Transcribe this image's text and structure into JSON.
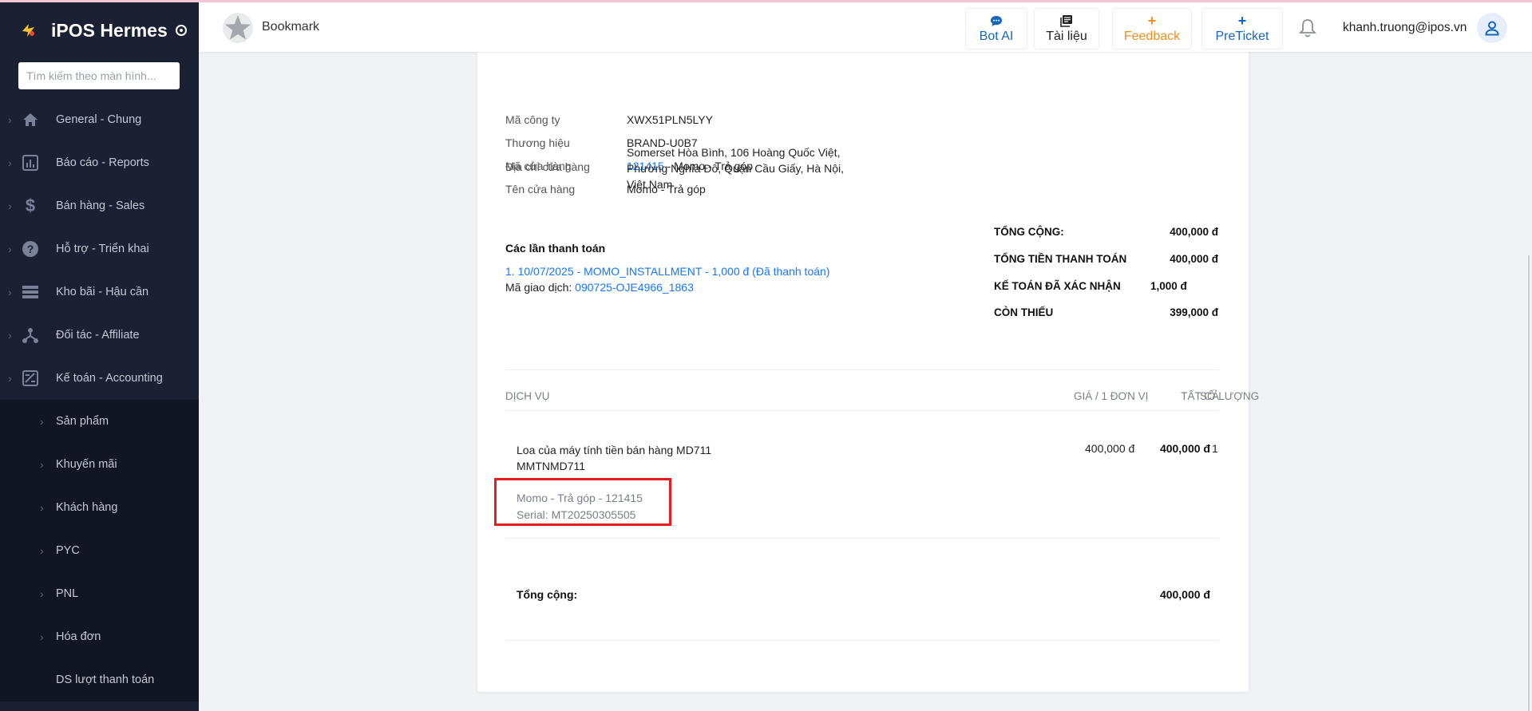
{
  "app": {
    "name": "iPOS Hermes"
  },
  "sidebar": {
    "search_placeholder": "Tìm kiếm theo màn hình...",
    "items": [
      {
        "label": "General - Chung",
        "icon": "home-icon"
      },
      {
        "label": "Báo cáo - Reports",
        "icon": "report-icon"
      },
      {
        "label": "Bán hàng - Sales",
        "icon": "dollar-icon"
      },
      {
        "label": "Hỗ trợ - Triển khai",
        "icon": "help-icon"
      },
      {
        "label": "Kho bãi - Hậu cần",
        "icon": "warehouse-icon"
      },
      {
        "label": "Đối tác - Affiliate",
        "icon": "affiliate-icon"
      },
      {
        "label": "Kế toán - Accounting",
        "icon": "accounting-icon"
      }
    ],
    "sub_items": [
      {
        "label": "Sản phẩm"
      },
      {
        "label": "Khuyến mãi"
      },
      {
        "label": "Khách hàng"
      },
      {
        "label": "PYC"
      },
      {
        "label": "PNL"
      },
      {
        "label": "Hóa đơn"
      },
      {
        "label": "DS lượt thanh toán"
      }
    ]
  },
  "header": {
    "bookmark_label": "Bookmark",
    "buttons": {
      "bot_ai": "Bot AI",
      "docs": "Tài liệu",
      "feedback": "Feedback",
      "preticket": "PreTicket"
    },
    "user_email": "khanh.truong@ipos.vn"
  },
  "invoice": {
    "info": {
      "company_code_label": "Mã công ty",
      "company_code": "XWX51PLN5LYY",
      "brand_label": "Thương hiệu",
      "brand": "BRAND-U0B7",
      "store_code_label": "Mã cửa hàng",
      "store_code": "121415",
      "store_code_suffix": "- Momo - Trả góp",
      "store_name_label": "Tên cửa hàng",
      "store_name": "Momo - Trả góp",
      "store_address_label": "Địa chỉ cửa hàng",
      "store_address": "Somerset Hòa Bình, 106 Hoàng Quốc Việt, Phường Nghĩa Đô, Quận Cầu Giấy, Hà Nội, Việt Nam"
    },
    "payments": {
      "title": "Các lần thanh toán",
      "line": "1. 10/07/2025 - MOMO_INSTALLMENT - 1,000 đ (Đã thanh toán)",
      "txn_label": "Mã giao dịch:",
      "txn_code": "090725-OJE4966_1863"
    },
    "totals": {
      "total_label": "TỔNG CỘNG:",
      "total_value": "400,000 đ",
      "payable_label": "TỔNG TIỀN THANH TOÁN",
      "payable_value": "400,000 đ",
      "confirmed_label": "KẾ TOÁN ĐÃ XÁC NHẬN",
      "confirmed_value": "1,000 đ",
      "remaining_label": "CÒN THIẾU",
      "remaining_value": "399,000 đ"
    },
    "table": {
      "headers": {
        "service": "DỊCH VỤ",
        "unit_price": "GIÁ / 1 ĐƠN VỊ",
        "quantity": "SỐ LƯỢNG",
        "total": "TẤT CẢ"
      },
      "row": {
        "name": "Loa của máy tính tiền bán hàng MD711",
        "code": "MMTNMD711",
        "store_line": "Momo - Trả góp - 121415",
        "serial": "Serial: MT20250305505",
        "unit_price": "400,000 đ",
        "quantity": "1",
        "total": "400,000 đ"
      },
      "grand_total_label": "Tổng cộng:",
      "grand_total_value": "400,000 đ"
    }
  },
  "colors": {
    "sidebar_bg": "#1b2033",
    "link": "#1677ff",
    "feedback": "#f0901f",
    "highlight": "#e81c1c"
  }
}
